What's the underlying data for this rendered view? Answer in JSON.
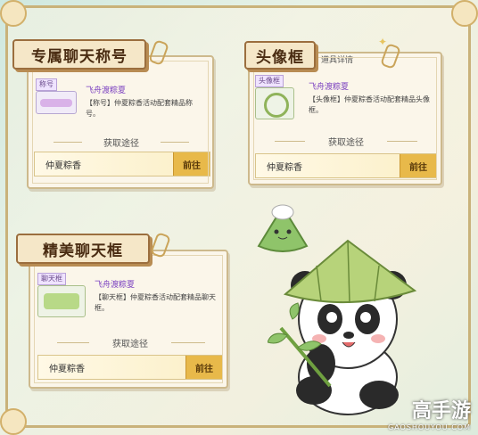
{
  "cards": {
    "title_card": {
      "banner": "专属聊天称号",
      "tag": "称号",
      "item_name": "飞舟渡粽夏",
      "item_desc": "【称号】仲夏粽香活动配套精品称号。",
      "route_title": "获取途径",
      "route_source": "仲夏粽香",
      "go_label": "前往"
    },
    "avatar_card": {
      "banner": "头像框",
      "header_label": "道具详情",
      "tag": "头像框",
      "item_name": "飞舟渡粽夏",
      "item_desc": "【头像框】仲夏粽香活动配套精品头像框。",
      "route_title": "获取途径",
      "route_source": "仲夏粽香",
      "go_label": "前往"
    },
    "chat_card": {
      "banner": "精美聊天框",
      "tag": "聊天框",
      "item_name": "飞舟渡粽夏",
      "item_desc": "【聊天框】仲夏粽香活动配套精品聊天框。",
      "route_title": "获取途径",
      "route_source": "仲夏粽香",
      "go_label": "前往"
    }
  },
  "watermark": {
    "brand": "高手游",
    "url": "GAOSHOUYOU.COM"
  },
  "colors": {
    "accent_gold": "#e8b94a",
    "item_purple": "#7a3fc0",
    "banner_brown": "#9b6e3e"
  }
}
